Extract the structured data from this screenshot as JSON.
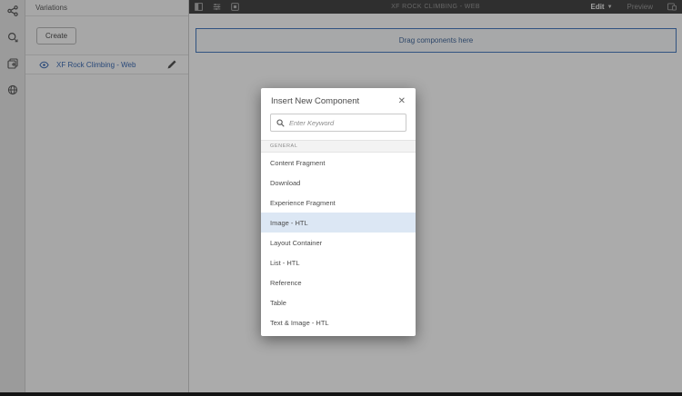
{
  "left_rail": {
    "icons": [
      {
        "name": "share-icon"
      },
      {
        "name": "launches-icon"
      },
      {
        "name": "copy-add-icon"
      },
      {
        "name": "globe-icon"
      }
    ]
  },
  "variations_panel": {
    "title": "Variations",
    "create_button": "Create",
    "variation": {
      "label": "XF Rock Climbing - Web"
    }
  },
  "toolbar": {
    "title": "XF ROCK CLIMBING - WEB",
    "edit_label": "Edit",
    "chevron": "▼",
    "preview_label": "Preview"
  },
  "canvas": {
    "drop_zone_label": "Drag components here"
  },
  "dialog": {
    "title": "Insert New Component",
    "close_label": "✕",
    "search_placeholder": "Enter Keyword",
    "section_label": "GENERAL",
    "items": [
      "Content Fragment",
      "Download",
      "Experience Fragment",
      "Image - HTL",
      "Layout Container",
      "List - HTL",
      "Reference",
      "Table",
      "Text & Image - HTL"
    ],
    "selected_item": "Image - HTL"
  },
  "colors": {
    "accent_blue": "#4a7dc0",
    "link_blue": "#3e6db5",
    "selection_bg": "#dce7f4",
    "toolbar_bg": "#464646"
  }
}
